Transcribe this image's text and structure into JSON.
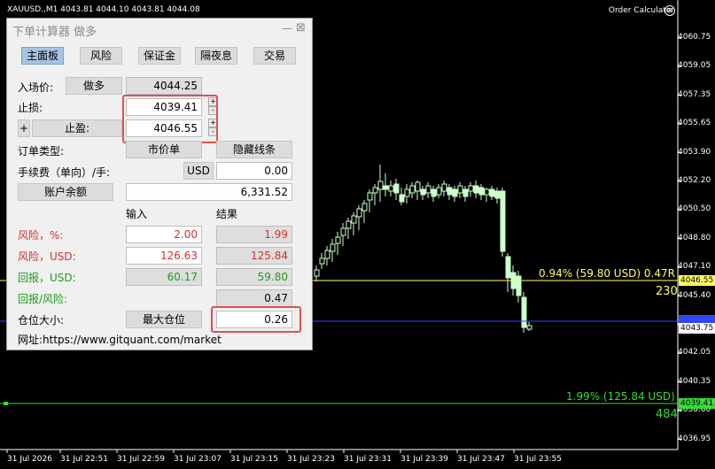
{
  "chart": {
    "header_info": "XAUUSD.,M1  4043.81 4044.10 4043.81 4044.08",
    "order_calculator_label": "Order Calculator",
    "price_axis": [
      "4060.75",
      "4059.05",
      "4057.35",
      "4055.65",
      "4053.90",
      "4052.20",
      "4050.50",
      "4048.80",
      "4047.10",
      "4045.40",
      "4043.75",
      "4042.05",
      "4040.35",
      "4038.60",
      "4036.95"
    ],
    "time_axis": [
      "31 Jul 2026",
      "31 Jul 22:51",
      "31 Jul 22:59",
      "31 Jul 23:07",
      "31 Jul 23:15",
      "31 Jul 23:23",
      "31 Jul 23:31",
      "31 Jul 23:39",
      "31 Jul 23:47",
      "31 Jul 23:55"
    ],
    "tp_line": {
      "label": "0.94% (59.80 USD) 0.47R",
      "points": "230",
      "price_tag": "4046.55",
      "color": "#ffff66"
    },
    "sl_line": {
      "label": "1.99% (125.84 USD)",
      "points": "484",
      "price_tag": "4039.41",
      "color": "#33dd33"
    },
    "entry_line": {
      "price_tag": "4044.25",
      "color": "#3344ff"
    },
    "current_price": "4043.75"
  },
  "panel": {
    "title": "下单计算器 做多",
    "tabs": [
      {
        "label": "主面板",
        "active": true
      },
      {
        "label": "风险",
        "active": false
      },
      {
        "label": "保证金",
        "active": false
      },
      {
        "label": "隔夜息",
        "active": false
      },
      {
        "label": "交易",
        "active": false
      }
    ],
    "entry": {
      "label": "入场价:",
      "direction_button": "做多",
      "value": "4044.25"
    },
    "stop_loss": {
      "label": "止损:",
      "value": "4039.41"
    },
    "take_profit": {
      "plus": "+",
      "button": "止盈:",
      "value": "4046.55"
    },
    "order_type": {
      "label": "订单类型:",
      "button": "市价单",
      "hide_lines_button": "隐藏线条"
    },
    "commission": {
      "label": "手续费（单向）/手:",
      "currency": "USD",
      "value": "0.00"
    },
    "balance": {
      "button": "账户余额",
      "value": "6,331.52"
    },
    "headers": {
      "input": "输入",
      "result": "结果"
    },
    "risk_pct": {
      "label": "风险，%:",
      "input": "2.00",
      "result": "1.99"
    },
    "risk_usd": {
      "label": "风险，USD:",
      "input": "126.63",
      "result": "125.84"
    },
    "reward_usd": {
      "label": "回报，USD:",
      "input": "60.17",
      "result": "59.80"
    },
    "rr": {
      "label": "回报/风险:",
      "result": "0.47"
    },
    "position": {
      "label": "仓位大小:",
      "max_button": "最大仓位",
      "value": "0.26"
    },
    "website": "网址:https://www.gitquant.com/market"
  }
}
